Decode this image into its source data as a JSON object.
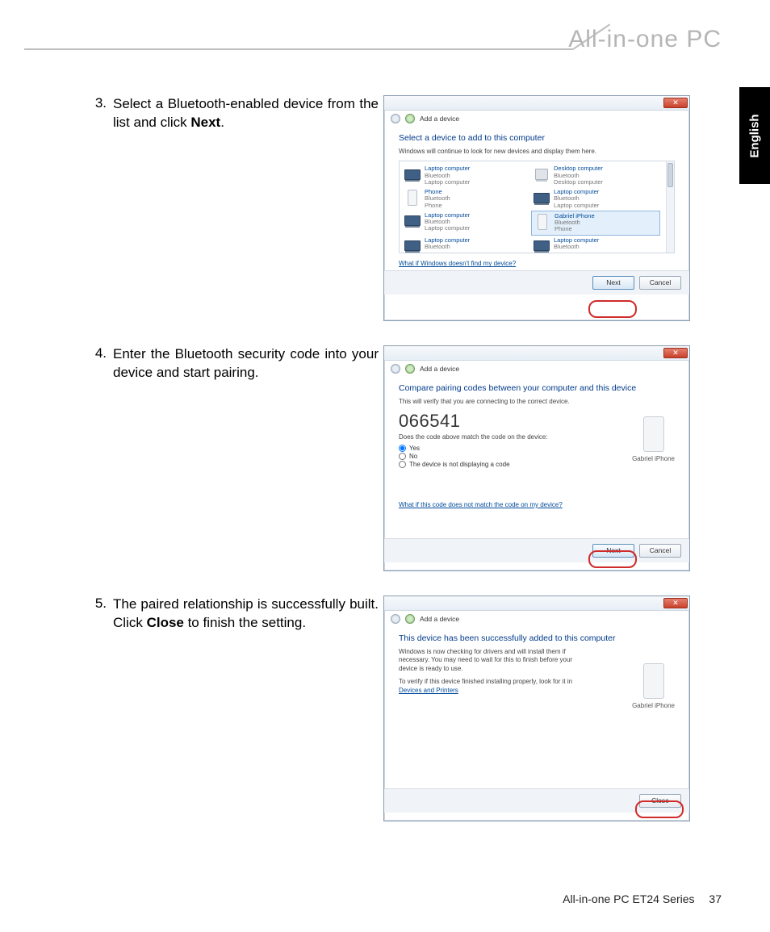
{
  "header": {
    "product_title": "All-in-one PC"
  },
  "lang_tab": "English",
  "steps": {
    "s3": {
      "num": "3.",
      "text_a": "Select a Bluetooth-enabled device from the list and click ",
      "bold": "Next",
      "text_b": "."
    },
    "s4": {
      "num": "4.",
      "text": "Enter the Bluetooth security code into your device and start pairing."
    },
    "s5": {
      "num": "5.",
      "text_a": "The paired relationship is successfully built. Click ",
      "bold": "Close",
      "text_b": " to finish the setting."
    }
  },
  "dialog_common": {
    "close_x": "✕",
    "nav_title": "Add a device"
  },
  "dialog1": {
    "heading": "Select a device to add to this computer",
    "sub": "Windows will continue to look for new devices and display them here.",
    "devices": [
      {
        "icon": "laptop",
        "l1": "Laptop computer",
        "l2": "Bluetooth",
        "l3": "Laptop computer"
      },
      {
        "icon": "desktop",
        "l1": "Desktop computer",
        "l2": "Bluetooth",
        "l3": "Desktop computer"
      },
      {
        "icon": "phone",
        "l1": "Phone",
        "l2": "Bluetooth",
        "l3": "Phone"
      },
      {
        "icon": "laptop",
        "l1": "Laptop computer",
        "l2": "Bluetooth",
        "l3": "Laptop computer"
      },
      {
        "icon": "laptop",
        "l1": "Laptop computer",
        "l2": "Bluetooth",
        "l3": "Laptop computer"
      },
      {
        "icon": "phone",
        "l1": "Gabriel iPhone",
        "l2": "Bluetooth",
        "l3": "Phone",
        "selected": true
      },
      {
        "icon": "laptop",
        "l1": "Laptop computer",
        "l2": "Bluetooth",
        "l3": ""
      },
      {
        "icon": "laptop",
        "l1": "Laptop computer",
        "l2": "Bluetooth",
        "l3": ""
      }
    ],
    "link": "What if Windows doesn't find my device?",
    "btn_next": "Next",
    "btn_cancel": "Cancel"
  },
  "dialog2": {
    "heading": "Compare pairing codes between your computer and this device",
    "sub": "This will verify that you are connecting to the correct device.",
    "code": "066541",
    "question": "Does the code above match the code on the device:",
    "opts": {
      "yes": "Yes",
      "no": "No",
      "none": "The device is not displaying a code"
    },
    "device_name": "Gabriel iPhone",
    "link": "What if this code does not match the code on my device?",
    "btn_next": "Next",
    "btn_cancel": "Cancel"
  },
  "dialog3": {
    "heading": "This device has been successfully added to this computer",
    "sub1": "Windows is now checking for drivers and will install them if necessary. You may need to wait for this to finish before your device is ready to use.",
    "sub2a": "To verify if this device finished installing properly, look for it in ",
    "sub2_link": "Devices and Printers",
    "device_name": "Gabriel iPhone",
    "btn_close": "Close"
  },
  "footer": {
    "series": "All-in-one PC ET24 Series",
    "page": "37"
  }
}
